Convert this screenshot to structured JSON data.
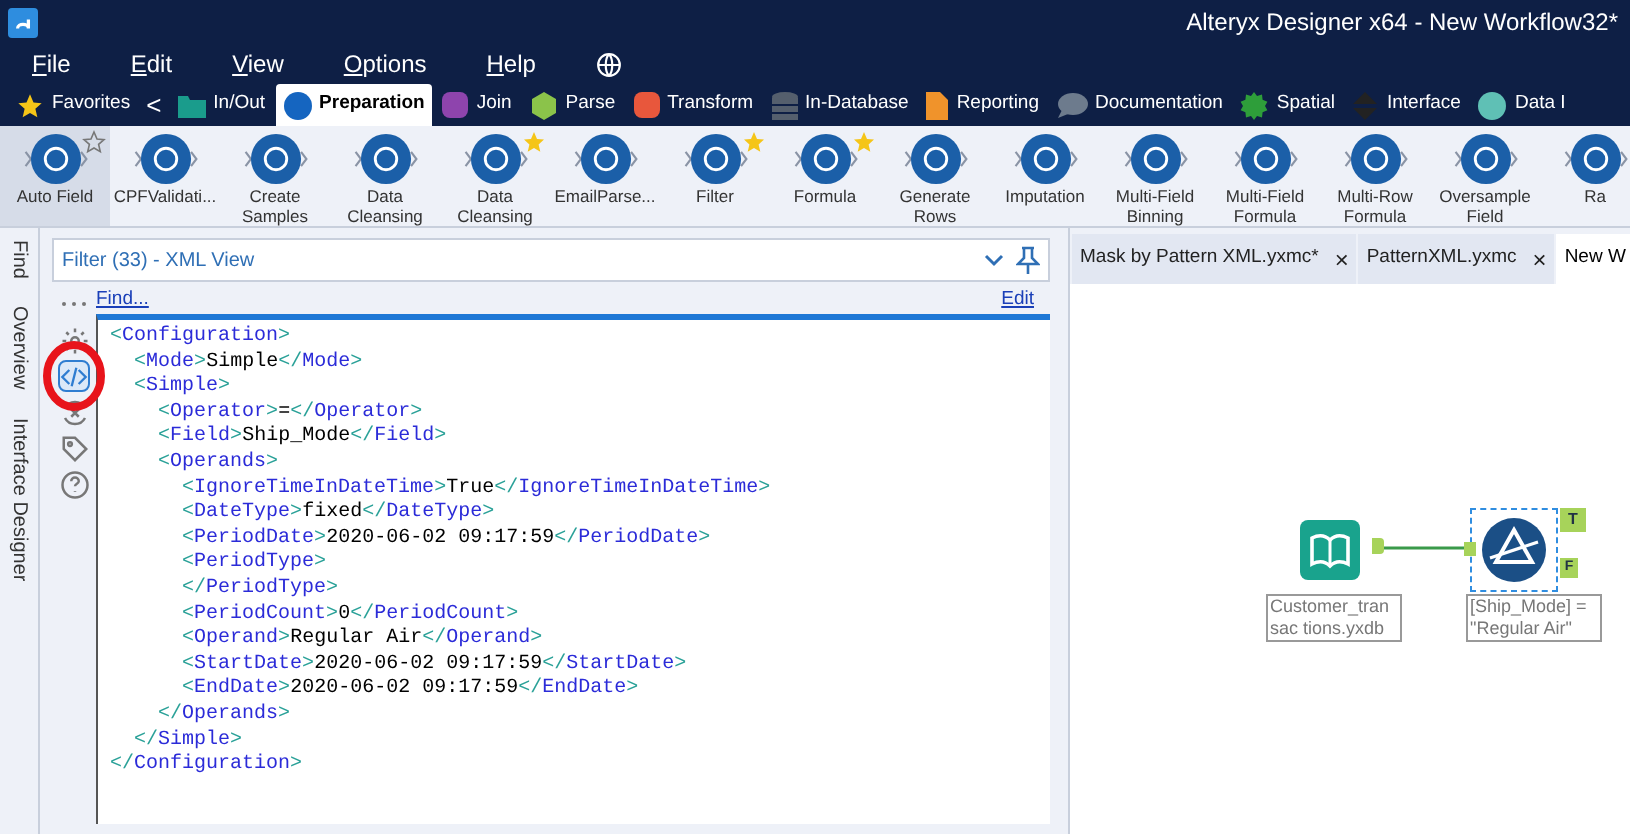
{
  "window": {
    "title": "Alteryx Designer x64 - New Workflow32*"
  },
  "menu": [
    "File",
    "Edit",
    "View",
    "Options",
    "Help"
  ],
  "categories": [
    {
      "label": "Favorites",
      "kind": "star",
      "selected": false
    },
    {
      "label": "<",
      "kind": "back",
      "selected": false
    },
    {
      "label": "In/Out",
      "kind": "folder",
      "color": "#1a9c8c",
      "selected": false
    },
    {
      "label": "Preparation",
      "kind": "dot",
      "color": "#1565c0",
      "selected": true
    },
    {
      "label": "Join",
      "kind": "square",
      "color": "#8e44ad",
      "selected": false
    },
    {
      "label": "Parse",
      "kind": "hex",
      "color": "#8bc34a",
      "selected": false
    },
    {
      "label": "Transform",
      "kind": "square",
      "color": "#e8573c",
      "selected": false
    },
    {
      "label": "In-Database",
      "kind": "db",
      "color": "#555f6d",
      "selected": false
    },
    {
      "label": "Reporting",
      "kind": "doc",
      "color": "#f0932b",
      "selected": false
    },
    {
      "label": "Documentation",
      "kind": "bubble",
      "color": "#6d7b8d",
      "selected": false
    },
    {
      "label": "Spatial",
      "kind": "gear",
      "color": "#2e9e3a",
      "selected": false
    },
    {
      "label": "Interface",
      "kind": "updown",
      "color": "#222222",
      "selected": false
    },
    {
      "label": "Data I",
      "kind": "dot",
      "color": "#5fc0b5",
      "selected": false
    }
  ],
  "tools": [
    {
      "label": "Auto Field",
      "favorite": false,
      "selected": true
    },
    {
      "label": "CPFValidati...",
      "favorite": false,
      "selected": false
    },
    {
      "label": "Create Samples",
      "favorite": false,
      "selected": false
    },
    {
      "label": "Data Cleansing",
      "favorite": false,
      "selected": false
    },
    {
      "label": "Data Cleansing",
      "favorite": true,
      "selected": false
    },
    {
      "label": "EmailParse...",
      "favorite": false,
      "selected": false
    },
    {
      "label": "Filter",
      "favorite": true,
      "selected": false
    },
    {
      "label": "Formula",
      "favorite": true,
      "selected": false
    },
    {
      "label": "Generate Rows",
      "favorite": false,
      "selected": false
    },
    {
      "label": "Imputation",
      "favorite": false,
      "selected": false
    },
    {
      "label": "Multi-Field Binning",
      "favorite": false,
      "selected": false
    },
    {
      "label": "Multi-Field Formula",
      "favorite": false,
      "selected": false
    },
    {
      "label": "Multi-Row Formula",
      "favorite": false,
      "selected": false
    },
    {
      "label": "Oversample Field",
      "favorite": false,
      "selected": false
    },
    {
      "label": "Ra",
      "favorite": false,
      "selected": false
    }
  ],
  "side_tabs": [
    {
      "label": "Find"
    },
    {
      "label": "Overview"
    },
    {
      "label": "Interface Designer"
    }
  ],
  "panel": {
    "title": "Filter (33) - XML View",
    "find_link": "Find...",
    "edit_link": "Edit",
    "side_icons": [
      {
        "kind": "more",
        "selected": false
      },
      {
        "kind": "gear",
        "selected": false
      },
      {
        "kind": "xml",
        "selected": true
      },
      {
        "kind": "tools",
        "selected": false
      },
      {
        "kind": "tag",
        "selected": false
      },
      {
        "kind": "help",
        "selected": false
      }
    ],
    "xml_lines": [
      "<Configuration>",
      "  <Mode>Simple</Mode>",
      "  <Simple>",
      "    <Operator>=</Operator>",
      "    <Field>Ship_Mode</Field>",
      "    <Operands>",
      "      <IgnoreTimeInDateTime>True</IgnoreTimeInDateTime>",
      "      <DateType>fixed</DateType>",
      "      <PeriodDate>2020-06-02 09:17:59</PeriodDate>",
      "      <PeriodType>",
      "      </PeriodType>",
      "      <PeriodCount>0</PeriodCount>",
      "      <Operand>Regular Air</Operand>",
      "      <StartDate>2020-06-02 09:17:59</StartDate>",
      "      <EndDate>2020-06-02 09:17:59</EndDate>",
      "    </Operands>",
      "  </Simple>",
      "</Configuration>"
    ]
  },
  "doc_tabs": [
    {
      "label": "Mask by Pattern XML.yxmc*",
      "close": "×",
      "selected": false
    },
    {
      "label": "PatternXML.yxmc",
      "close": "×",
      "selected": false
    },
    {
      "label": "New W",
      "selected": true
    }
  ],
  "canvas": {
    "nodes": [
      {
        "kind": "input",
        "label": "Customer_transac tions.yxdb",
        "selected": false
      },
      {
        "kind": "filter",
        "label": "[Ship_Mode] = \"Regular Air\"",
        "selected": true,
        "true_anchor": "T",
        "false_anchor": "F"
      }
    ]
  }
}
